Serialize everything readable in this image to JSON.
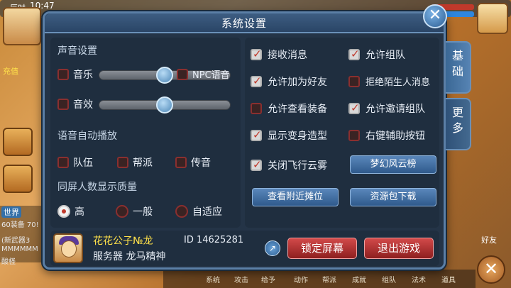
{
  "hud": {
    "clock_label": "辰时",
    "time": "10:47",
    "recharge_label": "充值",
    "chat_channel": "世界",
    "chat_lines": [
      "60装备 70!",
      "(新武器3",
      "MMMMMM",
      "酸柽"
    ],
    "friend_label": "好友",
    "bottom_items": [
      "系统",
      "攻击",
      "给予",
      "动作",
      "帮派",
      "成就",
      "组队",
      "法术",
      "道具"
    ]
  },
  "dialog": {
    "title": "系统设置",
    "close_glyph": "✕",
    "sound": {
      "section_title": "声音设置",
      "music_label": "音乐",
      "music_checked": false,
      "music_volume": 0.5,
      "npc_voice_label": "NPC语音",
      "npc_voice_checked": false,
      "effects_label": "音效",
      "effects_checked": false,
      "effects_volume": 0.5
    },
    "auto_voice": {
      "section_title": "语音自动播放",
      "options": [
        {
          "label": "队伍",
          "checked": false
        },
        {
          "label": "帮派",
          "checked": false
        },
        {
          "label": "传音",
          "checked": false
        }
      ]
    },
    "quality": {
      "section_title": "同屏人数显示质量",
      "options": [
        {
          "label": "高",
          "selected": true
        },
        {
          "label": "一般",
          "selected": false
        },
        {
          "label": "自适应",
          "selected": false
        }
      ]
    },
    "right_options": [
      {
        "label": "接收消息",
        "checked": true
      },
      {
        "label": "允许组队",
        "checked": true
      },
      {
        "label": "允许加为好友",
        "checked": true
      },
      {
        "label": "拒绝陌生人消息",
        "checked": false
      },
      {
        "label": "允许查看装备",
        "checked": false
      },
      {
        "label": "允许邀请组队",
        "checked": true
      },
      {
        "label": "显示变身造型",
        "checked": true
      },
      {
        "label": "右键辅助按钮",
        "checked": false
      },
      {
        "label": "关闭飞行云雾",
        "checked": true
      }
    ],
    "buttons": {
      "fantasy_rank": "梦幻风云榜",
      "nearby_stalls": "查看附近摊位",
      "resource_download": "资源包下载",
      "lock_screen": "锁定屏幕",
      "exit_game": "退出游戏"
    },
    "player": {
      "name": "花花公子№龙",
      "id_label": "ID 14625281",
      "server_label": "服务器 龙马精神"
    },
    "tabs": [
      {
        "label": "基础",
        "active": true
      },
      {
        "label": "更多",
        "active": false
      }
    ],
    "colors": {
      "panel": "#243447",
      "accent_blue": "#5a87bb",
      "accent_red": "#c0392b",
      "name_gold": "#ffe14a"
    }
  }
}
